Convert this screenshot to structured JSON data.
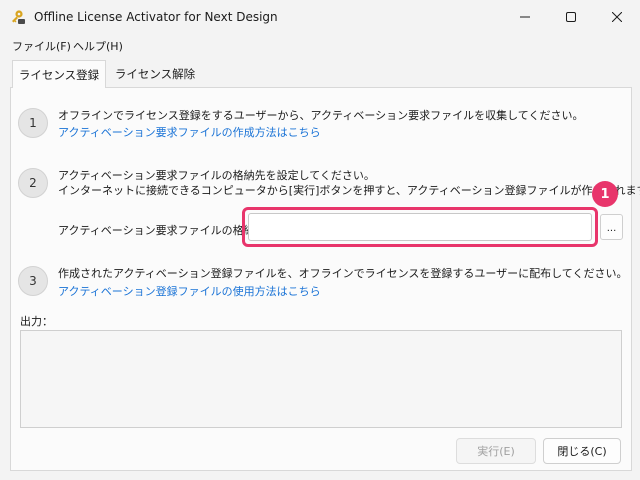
{
  "window": {
    "title": "Offline License Activator for Next Design"
  },
  "menu": {
    "file": "ファイル(F)",
    "help": "ヘルプ(H)"
  },
  "tabs": [
    {
      "label": "ライセンス登録"
    },
    {
      "label": "ライセンス解除"
    }
  ],
  "steps": [
    {
      "number": "1",
      "text1": "オフラインでライセンス登録をするユーザーから、アクティベーション要求ファイルを収集してください。",
      "link": "アクティベーション要求ファイルの作成方法はこちら"
    },
    {
      "number": "2",
      "text1": "アクティベーション要求ファイルの格納先を設定してください。",
      "text2": "インターネットに接続できるコンピュータから[実行]ボタンを押すと、アクティベーション登録ファイルが作成されます。",
      "field_label": "アクティベーション要求ファイルの格納先",
      "field_value": "",
      "browse_label": "...",
      "badge": "1"
    },
    {
      "number": "3",
      "text1": "作成されたアクティベーション登録ファイルを、オフラインでライセンスを登録するユーザーに配布してください。",
      "link": "アクティベーション登録ファイルの使用方法はこちら"
    }
  ],
  "output": {
    "label": "出力："
  },
  "buttons": {
    "run": "実行(E)",
    "close": "閉じる(C)"
  },
  "colors": {
    "highlight": "#e8356b",
    "link": "#1a73d6"
  }
}
